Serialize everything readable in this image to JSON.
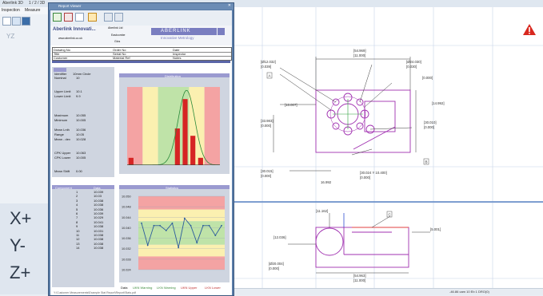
{
  "app": {
    "window_title": "Aberlink 3D",
    "tab": "1 / 2 / 3D"
  },
  "menu": {
    "items": [
      "Inspection",
      "Measure"
    ]
  },
  "left_panel": {
    "view_label": "YZ"
  },
  "axis_controls": {
    "x_label": "X+",
    "y_label": "Y-",
    "z_label": "Z+"
  },
  "report": {
    "window_title": "Report Viewer",
    "company_name": "Aberlink Innovati...",
    "company_sub": "www.aberlink.co.uk",
    "logo_text": "ABERLINK",
    "logo_sub": "Innovative Metrology",
    "header_top": "Aberlink Ltd",
    "header_mid": "Eastcombe",
    "header_bot": "Glos",
    "fields": [
      {
        "label": "Drawing No",
        "value": "",
        "label2": "Order No",
        "value2": "",
        "label3": "Date",
        "value3": ""
      },
      {
        "label": "Title",
        "value": "",
        "label2": "Serial No",
        "value2": "",
        "label3": "Inspector",
        "value3": ""
      },
      {
        "label": "Customer",
        "value": "",
        "label2": "Material Ref",
        "value2": "",
        "label3": "Notes",
        "value3": ""
      }
    ],
    "stats": {
      "identifier_label": "Identifier",
      "identifier_value": "10mm Circle",
      "nominal_label": "Nominal",
      "nominal_value": "10",
      "upper_limit_label": "Upper Limit",
      "upper_limit_value": "10.1",
      "lower_limit_label": "Lower Limit",
      "lower_limit_value": "9.9",
      "maximum_label": "Maximum",
      "maximum_value": "10.055",
      "minimum_label": "Minimum",
      "minimum_value": "10.005",
      "mean_label": "Mean Lnth",
      "mean_value": "10.036",
      "range_label": "Range",
      "range_value": "10.05",
      "mean_dev_label": "Mean - dev",
      "mean_dev_value": "10.028",
      "cpk_upper_label": "CPK Upper",
      "cpk_upper_value": "10.063",
      "cpk_lower_label": "CPK Lower",
      "cpk_lower_value": "10.005",
      "mean_shift_label": "Mean Shift",
      "mean_shift_value": "0.00"
    },
    "distribution_title": "Distribution",
    "runchart_title": "Statistics",
    "components": {
      "header_left": "Component",
      "header_right": "Data",
      "rows": [
        [
          "1",
          "10.039"
        ],
        [
          "2",
          "10.03"
        ],
        [
          "3",
          "10.038"
        ],
        [
          "4",
          "10.038"
        ],
        [
          "5",
          "10.036"
        ],
        [
          "6",
          "10.039"
        ],
        [
          "7",
          "10.029"
        ],
        [
          "8",
          "10.041"
        ],
        [
          "9",
          "10.038"
        ],
        [
          "10",
          "10.031"
        ],
        [
          "11",
          "10.038"
        ],
        [
          "12",
          "10.038"
        ],
        [
          "13",
          "10.038"
        ],
        [
          "14",
          "10.038"
        ]
      ]
    },
    "legend": [
      "Data",
      "UKN Warning",
      "LKN Warning",
      "UKN Upper",
      "LKN Lower"
    ],
    "footer": "Y:\\Customer Measurements\\Example Stat Report\\Report\\Stats.pdf"
  },
  "cad_view": {
    "dims": [
      "[54.969]",
      "[11.000]",
      "[Ø12.032]",
      "[0.039]",
      "[Ø24.030]",
      "[0.030]",
      "[0.000]",
      "[10.007]",
      "[14.992]",
      "[33.983]",
      "[0.000]",
      "[30.010]",
      "[0.000]",
      "16.992",
      "[30.015]",
      "[0.000]",
      "[30.024 Y 10.400]",
      "[0.000]",
      "[11.162]",
      "[12.036]",
      "[5.001]",
      "[Ø20.004]",
      "[0.000]",
      "[54.963]",
      "[11.000]"
    ],
    "labels": [
      "A",
      "B",
      "C"
    ],
    "status_text": "-46.86 cam 10 Eb 1  DRO(0)"
  },
  "chart_data": [
    {
      "type": "bar",
      "title": "Distribution",
      "categories": [
        "1",
        "2",
        "3",
        "4",
        "5",
        "6",
        "7",
        "8",
        "9",
        "10",
        "11",
        "12"
      ],
      "values": [
        1,
        0,
        0,
        0,
        0,
        0,
        5,
        9,
        4,
        1,
        0,
        0
      ],
      "ylim": [
        0,
        10
      ],
      "grid": false
    },
    {
      "type": "line",
      "title": "Statistics",
      "x": [
        1,
        2,
        3,
        4,
        5,
        6,
        7,
        8,
        9,
        10,
        11,
        12,
        13,
        14
      ],
      "series": [
        {
          "values": [
            10.039,
            10.03,
            10.038,
            10.038,
            10.036,
            10.039,
            10.029,
            10.041,
            10.038,
            10.031,
            10.038,
            10.038,
            10.034,
            10.038
          ]
        }
      ],
      "ylim": [
        10.02,
        10.05
      ],
      "yticks": [
        "10.050",
        "10.048",
        "10.044",
        "10.040",
        "10.036",
        "10.032",
        "10.028",
        "10.024"
      ]
    }
  ],
  "colors": {
    "band_red": "#f4a3a3",
    "band_yellow": "#fbf0b0",
    "band_green": "#bfe3a8",
    "bar": "#d62424",
    "line": "#2c5b9c",
    "accent": "#9a9ad0"
  }
}
